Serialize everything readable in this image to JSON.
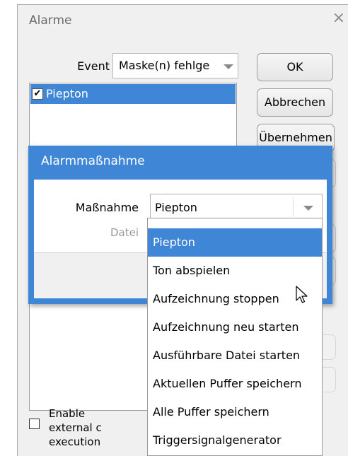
{
  "main_dialog": {
    "title": "Alarme",
    "close_glyph": "×",
    "event_label": "Event",
    "event_value": "Maske(n) fehlge",
    "list_items": [
      {
        "label": "Piepton",
        "checked": true
      }
    ],
    "buttons": {
      "ok": "OK",
      "cancel": "Abbrechen",
      "apply": "Übernehmen"
    },
    "enable_external_label": "Enable external c\nexecution"
  },
  "action_dialog": {
    "title": "Alarmmaßnahme",
    "massnahme_label": "Maßnahme",
    "massnahme_value": "Piepton",
    "datei_label": "Datei"
  },
  "dropdown": {
    "options": [
      "Piepton",
      "Ton abspielen",
      "Aufzeichnung stoppen",
      "Aufzeichnung neu starten",
      "Ausführbare Datei starten",
      "Aktuellen Puffer speichern",
      "Alle Puffer speichern",
      "Triggersignalgenerator"
    ],
    "selected_index": 0
  },
  "colors": {
    "accent": "#3f86d6",
    "window_bg": "#f0f0f0"
  },
  "icons": {
    "close": "close-icon",
    "checkbox": "checkbox-icon",
    "cursor": "mouse-pointer-icon",
    "dropdown_arrow": "chevron-down-icon"
  }
}
